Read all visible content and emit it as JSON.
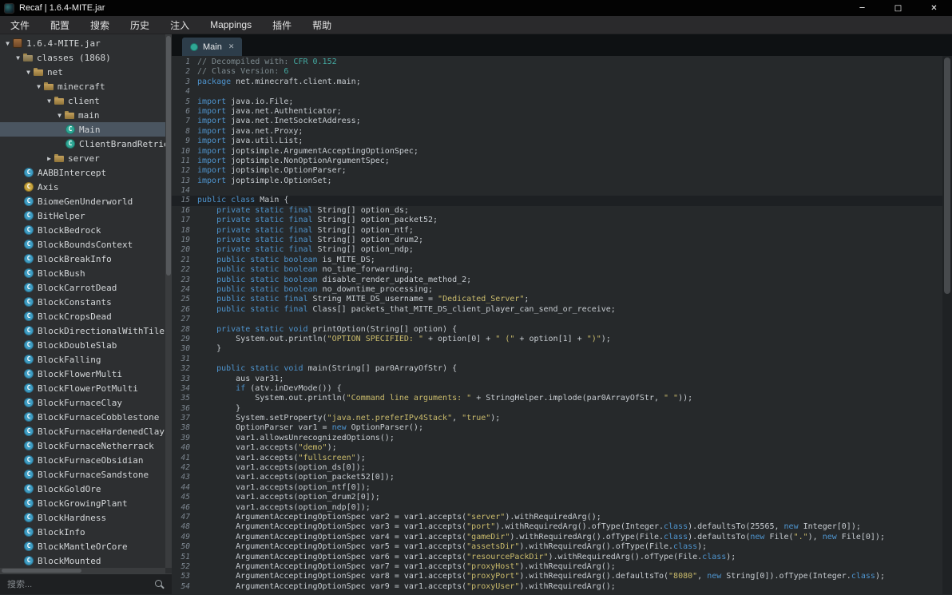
{
  "window": {
    "title": "Recaf | 1.6.4-MITE.jar",
    "controls": {
      "minimize": "─",
      "maximize": "□",
      "close": "✕"
    }
  },
  "menubar": {
    "items": [
      "文件",
      "配置",
      "搜索",
      "历史",
      "注入",
      "Mappings",
      "插件",
      "帮助"
    ]
  },
  "sidebar": {
    "search_placeholder": "搜索...",
    "tree": [
      {
        "depth": 0,
        "label": "1.6.4-MITE.jar",
        "icon": "jar",
        "arrow": "open"
      },
      {
        "depth": 1,
        "label": "classes (1868)",
        "icon": "folder",
        "arrow": "open"
      },
      {
        "depth": 2,
        "label": "net",
        "icon": "package",
        "arrow": "open"
      },
      {
        "depth": 3,
        "label": "minecraft",
        "icon": "package",
        "arrow": "open"
      },
      {
        "depth": 4,
        "label": "client",
        "icon": "package",
        "arrow": "open"
      },
      {
        "depth": 5,
        "label": "main",
        "icon": "package",
        "arrow": "open"
      },
      {
        "depth": 6,
        "label": "Main",
        "icon": "class-green",
        "selected": true
      },
      {
        "depth": 6,
        "label": "ClientBrandRetriever",
        "icon": "class-green"
      },
      {
        "depth": 4,
        "label": "server",
        "icon": "package",
        "arrow": "closed"
      },
      {
        "depth": 2,
        "label": "AABBIntercept",
        "icon": "class"
      },
      {
        "depth": 2,
        "label": "Axis",
        "icon": "class-yellow"
      },
      {
        "depth": 2,
        "label": "BiomeGenUnderworld",
        "icon": "class"
      },
      {
        "depth": 2,
        "label": "BitHelper",
        "icon": "class"
      },
      {
        "depth": 2,
        "label": "BlockBedrock",
        "icon": "class"
      },
      {
        "depth": 2,
        "label": "BlockBoundsContext",
        "icon": "class"
      },
      {
        "depth": 2,
        "label": "BlockBreakInfo",
        "icon": "class"
      },
      {
        "depth": 2,
        "label": "BlockBush",
        "icon": "class"
      },
      {
        "depth": 2,
        "label": "BlockCarrotDead",
        "icon": "class"
      },
      {
        "depth": 2,
        "label": "BlockConstants",
        "icon": "class"
      },
      {
        "depth": 2,
        "label": "BlockCropsDead",
        "icon": "class"
      },
      {
        "depth": 2,
        "label": "BlockDirectionalWithTileEn",
        "icon": "class"
      },
      {
        "depth": 2,
        "label": "BlockDoubleSlab",
        "icon": "class"
      },
      {
        "depth": 2,
        "label": "BlockFalling",
        "icon": "class"
      },
      {
        "depth": 2,
        "label": "BlockFlowerMulti",
        "icon": "class"
      },
      {
        "depth": 2,
        "label": "BlockFlowerPotMulti",
        "icon": "class"
      },
      {
        "depth": 2,
        "label": "BlockFurnaceClay",
        "icon": "class"
      },
      {
        "depth": 2,
        "label": "BlockFurnaceCobblestone",
        "icon": "class"
      },
      {
        "depth": 2,
        "label": "BlockFurnaceHardenedClay",
        "icon": "class"
      },
      {
        "depth": 2,
        "label": "BlockFurnaceNetherrack",
        "icon": "class"
      },
      {
        "depth": 2,
        "label": "BlockFurnaceObsidian",
        "icon": "class"
      },
      {
        "depth": 2,
        "label": "BlockFurnaceSandstone",
        "icon": "class"
      },
      {
        "depth": 2,
        "label": "BlockGoldOre",
        "icon": "class"
      },
      {
        "depth": 2,
        "label": "BlockGrowingPlant",
        "icon": "class"
      },
      {
        "depth": 2,
        "label": "BlockHardness",
        "icon": "class"
      },
      {
        "depth": 2,
        "label": "BlockInfo",
        "icon": "class"
      },
      {
        "depth": 2,
        "label": "BlockMantleOrCore",
        "icon": "class"
      },
      {
        "depth": 2,
        "label": "BlockMounted",
        "icon": "class"
      }
    ]
  },
  "editor": {
    "tab": {
      "label": "Main",
      "close": "✕"
    },
    "highlight_line": 15,
    "lines": [
      [
        [
          "c",
          "// Decompiled with: "
        ],
        [
          "ct",
          "CFR 0.152"
        ]
      ],
      [
        [
          "c",
          "// Class Version: "
        ],
        [
          "ct",
          "6"
        ]
      ],
      [
        [
          "k",
          "package"
        ],
        [
          "p",
          " net.minecraft.client.main;"
        ]
      ],
      [],
      [
        [
          "k",
          "import"
        ],
        [
          "p",
          " java.io.File;"
        ]
      ],
      [
        [
          "k",
          "import"
        ],
        [
          "p",
          " java.net.Authenticator;"
        ]
      ],
      [
        [
          "k",
          "import"
        ],
        [
          "p",
          " java.net.InetSocketAddress;"
        ]
      ],
      [
        [
          "k",
          "import"
        ],
        [
          "p",
          " java.net.Proxy;"
        ]
      ],
      [
        [
          "k",
          "import"
        ],
        [
          "p",
          " java.util.List;"
        ]
      ],
      [
        [
          "k",
          "import"
        ],
        [
          "p",
          " joptsimple.ArgumentAcceptingOptionSpec;"
        ]
      ],
      [
        [
          "k",
          "import"
        ],
        [
          "p",
          " joptsimple.NonOptionArgumentSpec;"
        ]
      ],
      [
        [
          "k",
          "import"
        ],
        [
          "p",
          " joptsimple.OptionParser;"
        ]
      ],
      [
        [
          "k",
          "import"
        ],
        [
          "p",
          " joptsimple.OptionSet;"
        ]
      ],
      [],
      [
        [
          "k",
          "public"
        ],
        [
          "p",
          " "
        ],
        [
          "k",
          "class"
        ],
        [
          "p",
          " Main {"
        ]
      ],
      [
        [
          "p",
          "    "
        ],
        [
          "k",
          "private static final"
        ],
        [
          "p",
          " String[] option_ds;"
        ]
      ],
      [
        [
          "p",
          "    "
        ],
        [
          "k",
          "private static final"
        ],
        [
          "p",
          " String[] option_packet52;"
        ]
      ],
      [
        [
          "p",
          "    "
        ],
        [
          "k",
          "private static final"
        ],
        [
          "p",
          " String[] option_ntf;"
        ]
      ],
      [
        [
          "p",
          "    "
        ],
        [
          "k",
          "private static final"
        ],
        [
          "p",
          " String[] option_drum2;"
        ]
      ],
      [
        [
          "p",
          "    "
        ],
        [
          "k",
          "private static final"
        ],
        [
          "p",
          " String[] option_ndp;"
        ]
      ],
      [
        [
          "p",
          "    "
        ],
        [
          "k",
          "public static boolean"
        ],
        [
          "p",
          " is_MITE_DS;"
        ]
      ],
      [
        [
          "p",
          "    "
        ],
        [
          "k",
          "public static boolean"
        ],
        [
          "p",
          " no_time_forwarding;"
        ]
      ],
      [
        [
          "p",
          "    "
        ],
        [
          "k",
          "public static boolean"
        ],
        [
          "p",
          " disable_render_update_method_2;"
        ]
      ],
      [
        [
          "p",
          "    "
        ],
        [
          "k",
          "public static boolean"
        ],
        [
          "p",
          " no_downtime_processing;"
        ]
      ],
      [
        [
          "p",
          "    "
        ],
        [
          "k",
          "public static final"
        ],
        [
          "p",
          " String MITE_DS_username = "
        ],
        [
          "s",
          "\"Dedicated_Server\""
        ],
        [
          "p",
          ";"
        ]
      ],
      [
        [
          "p",
          "    "
        ],
        [
          "k",
          "public static final"
        ],
        [
          "p",
          " Class[] packets_that_MITE_DS_client_player_can_send_or_receive;"
        ]
      ],
      [],
      [
        [
          "p",
          "    "
        ],
        [
          "k",
          "private static void"
        ],
        [
          "p",
          " printOption(String[] option) {"
        ]
      ],
      [
        [
          "p",
          "        System.out.println("
        ],
        [
          "s",
          "\"OPTION SPECIFIED: \""
        ],
        [
          "p",
          " + option[0] + "
        ],
        [
          "s",
          "\" (\""
        ],
        [
          "p",
          " + option[1] + "
        ],
        [
          "s",
          "\")\""
        ],
        [
          "p",
          ");"
        ]
      ],
      [
        [
          "p",
          "    }"
        ]
      ],
      [],
      [
        [
          "p",
          "    "
        ],
        [
          "k",
          "public static void"
        ],
        [
          "p",
          " main(String[] par0ArrayOfStr) {"
        ]
      ],
      [
        [
          "p",
          "        aus var31;"
        ]
      ],
      [
        [
          "p",
          "        "
        ],
        [
          "k",
          "if"
        ],
        [
          "p",
          " (atv.inDevMode()) {"
        ]
      ],
      [
        [
          "p",
          "            System.out.println("
        ],
        [
          "s",
          "\"Command line arguments: \""
        ],
        [
          "p",
          " + StringHelper.implode(par0ArrayOfStr, "
        ],
        [
          "s",
          "\" \""
        ],
        [
          "p",
          "));"
        ]
      ],
      [
        [
          "p",
          "        }"
        ]
      ],
      [
        [
          "p",
          "        System.setProperty("
        ],
        [
          "s",
          "\"java.net.preferIPv4Stack\""
        ],
        [
          "p",
          ", "
        ],
        [
          "s",
          "\"true\""
        ],
        [
          "p",
          ");"
        ]
      ],
      [
        [
          "p",
          "        OptionParser var1 = "
        ],
        [
          "k",
          "new"
        ],
        [
          "p",
          " OptionParser();"
        ]
      ],
      [
        [
          "p",
          "        var1.allowsUnrecognizedOptions();"
        ]
      ],
      [
        [
          "p",
          "        var1.accepts("
        ],
        [
          "s",
          "\"demo\""
        ],
        [
          "p",
          ");"
        ]
      ],
      [
        [
          "p",
          "        var1.accepts("
        ],
        [
          "s",
          "\"fullscreen\""
        ],
        [
          "p",
          ");"
        ]
      ],
      [
        [
          "p",
          "        var1.accepts(option_ds[0]);"
        ]
      ],
      [
        [
          "p",
          "        var1.accepts(option_packet52[0]);"
        ]
      ],
      [
        [
          "p",
          "        var1.accepts(option_ntf[0]);"
        ]
      ],
      [
        [
          "p",
          "        var1.accepts(option_drum2[0]);"
        ]
      ],
      [
        [
          "p",
          "        var1.accepts(option_ndp[0]);"
        ]
      ],
      [
        [
          "p",
          "        ArgumentAcceptingOptionSpec var2 = var1.accepts("
        ],
        [
          "s",
          "\"server\""
        ],
        [
          "p",
          ").withRequiredArg();"
        ]
      ],
      [
        [
          "p",
          "        ArgumentAcceptingOptionSpec var3 = var1.accepts("
        ],
        [
          "s",
          "\"port\""
        ],
        [
          "p",
          ").withRequiredArg().ofType(Integer."
        ],
        [
          "k",
          "class"
        ],
        [
          "p",
          ").defaultsTo(25565, "
        ],
        [
          "k",
          "new"
        ],
        [
          "p",
          " Integer[0]);"
        ]
      ],
      [
        [
          "p",
          "        ArgumentAcceptingOptionSpec var4 = var1.accepts("
        ],
        [
          "s",
          "\"gameDir\""
        ],
        [
          "p",
          ").withRequiredArg().ofType(File."
        ],
        [
          "k",
          "class"
        ],
        [
          "p",
          ").defaultsTo("
        ],
        [
          "k",
          "new"
        ],
        [
          "p",
          " File("
        ],
        [
          "s",
          "\".\""
        ],
        [
          "p",
          "), "
        ],
        [
          "k",
          "new"
        ],
        [
          "p",
          " File[0]);"
        ]
      ],
      [
        [
          "p",
          "        ArgumentAcceptingOptionSpec var5 = var1.accepts("
        ],
        [
          "s",
          "\"assetsDir\""
        ],
        [
          "p",
          ").withRequiredArg().ofType(File."
        ],
        [
          "k",
          "class"
        ],
        [
          "p",
          ");"
        ]
      ],
      [
        [
          "p",
          "        ArgumentAcceptingOptionSpec var6 = var1.accepts("
        ],
        [
          "s",
          "\"resourcePackDir\""
        ],
        [
          "p",
          ").withRequiredArg().ofType(File."
        ],
        [
          "k",
          "class"
        ],
        [
          "p",
          ");"
        ]
      ],
      [
        [
          "p",
          "        ArgumentAcceptingOptionSpec var7 = var1.accepts("
        ],
        [
          "s",
          "\"proxyHost\""
        ],
        [
          "p",
          ").withRequiredArg();"
        ]
      ],
      [
        [
          "p",
          "        ArgumentAcceptingOptionSpec var8 = var1.accepts("
        ],
        [
          "s",
          "\"proxyPort\""
        ],
        [
          "p",
          ").withRequiredArg().defaultsTo("
        ],
        [
          "s",
          "\"8080\""
        ],
        [
          "p",
          ", "
        ],
        [
          "k",
          "new"
        ],
        [
          "p",
          " String[0]).ofType(Integer."
        ],
        [
          "k",
          "class"
        ],
        [
          "p",
          ");"
        ]
      ],
      [
        [
          "p",
          "        ArgumentAcceptingOptionSpec var9 = var1.accepts("
        ],
        [
          "s",
          "\"proxyUser\""
        ],
        [
          "p",
          ").withRequiredArg();"
        ]
      ]
    ]
  },
  "colors": {
    "keyword": "#4e94ce",
    "string": "#cbbc6c",
    "comment": "#7d8a8f",
    "comment_accent": "#43a8a0",
    "plain": "#c8cdd2",
    "selection": "#4a5560",
    "editor_bg": "#26292b",
    "sidebar_bg": "#2d2f31",
    "titlebar_bg": "#030303"
  }
}
